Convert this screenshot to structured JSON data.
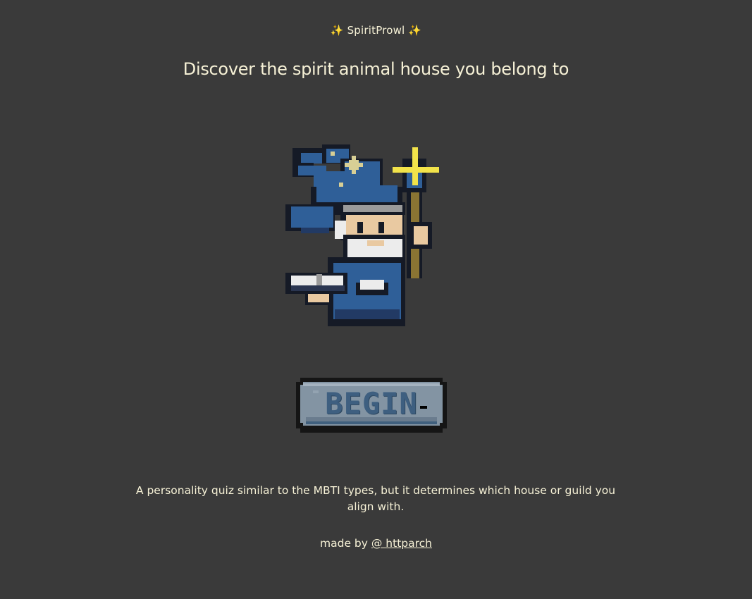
{
  "brand": {
    "sparkle_left": "✨",
    "name": "SpiritProwl",
    "sparkle_right": "✨"
  },
  "headline": "Discover the spirit animal house you belong to",
  "hero": {
    "icon": "pixel-wizard-icon"
  },
  "begin_button": {
    "label": "BEGIN"
  },
  "description": "A personality quiz similar to the MBTI types, but it determines which house or guild you align with.",
  "credit": {
    "prefix": "made by ",
    "link_text": "@ httparch"
  },
  "colors": {
    "background": "#3a3a3a",
    "text": "#f6f1d6",
    "button_face": "#8394a3",
    "button_text": "#3e5f80",
    "hat_blue": "#2f5f98",
    "staff_gold": "#f2e34a"
  }
}
